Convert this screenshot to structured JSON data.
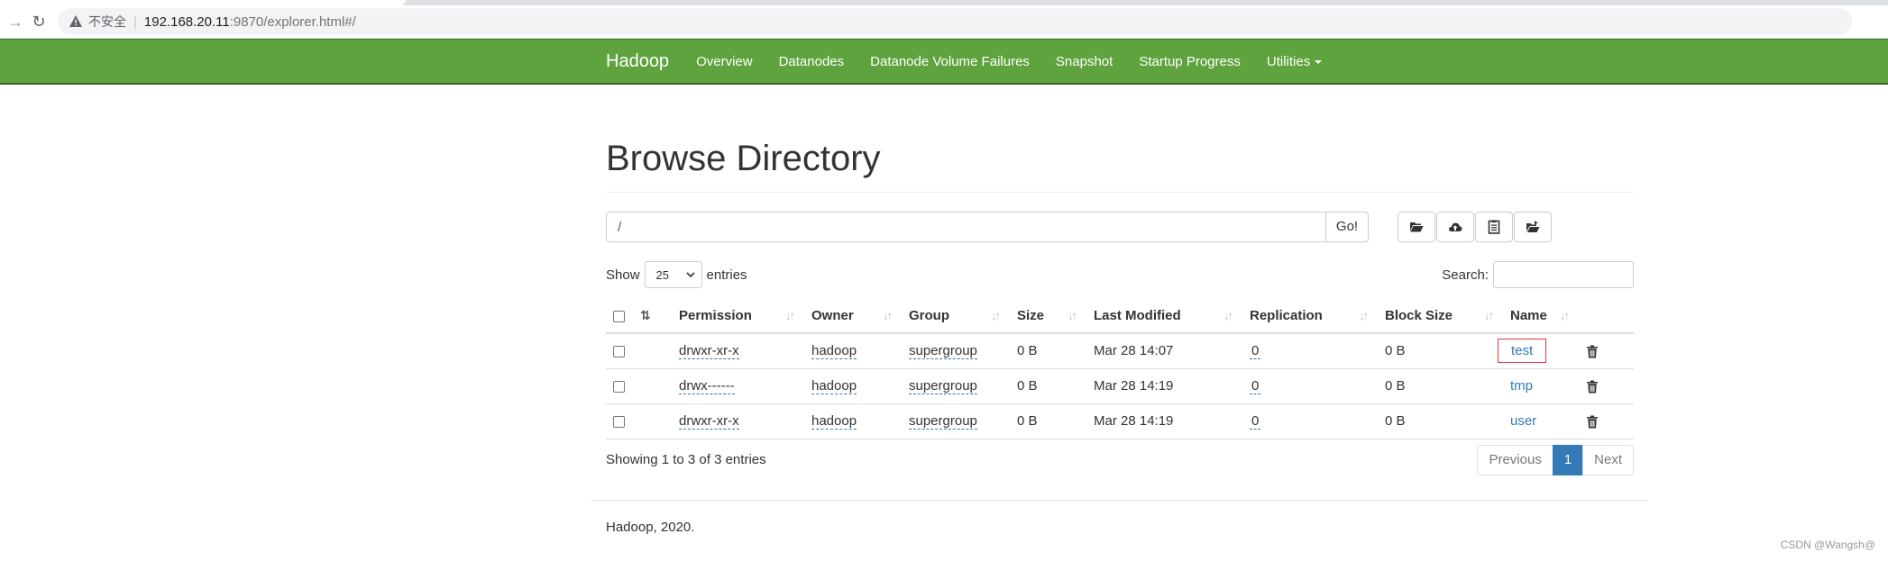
{
  "browser": {
    "insecure_label": "不安全",
    "url_host": "192.168.20.11",
    "url_path": ":9870/explorer.html#/"
  },
  "navbar": {
    "brand": "Hadoop",
    "links": [
      "Overview",
      "Datanodes",
      "Datanode Volume Failures",
      "Snapshot",
      "Startup Progress",
      "Utilities"
    ],
    "background_color": "#5fa33e"
  },
  "main": {
    "title": "Browse Directory",
    "path_value": "/",
    "go_label": "Go!",
    "toolbar_icons": [
      "folder-open-icon",
      "cloud-upload-icon",
      "clipboard-icon",
      "folder-open-alt-icon"
    ],
    "show_label": "Show",
    "entries_value": "25",
    "entries_label": "entries",
    "search_label": "Search:",
    "search_value": ""
  },
  "table": {
    "headers": [
      "Permission",
      "Owner",
      "Group",
      "Size",
      "Last Modified",
      "Replication",
      "Block Size",
      "Name"
    ],
    "rows": [
      {
        "permission": "drwxr-xr-x",
        "owner": "hadoop",
        "group": "supergroup",
        "size": "0 B",
        "modified": "Mar 28 14:07",
        "replication": "0",
        "block_size": "0 B",
        "name": "test"
      },
      {
        "permission": "drwx------",
        "owner": "hadoop",
        "group": "supergroup",
        "size": "0 B",
        "modified": "Mar 28 14:19",
        "replication": "0",
        "block_size": "0 B",
        "name": "tmp"
      },
      {
        "permission": "drwxr-xr-x",
        "owner": "hadoop",
        "group": "supergroup",
        "size": "0 B",
        "modified": "Mar 28 14:19",
        "replication": "0",
        "block_size": "0 B",
        "name": "user"
      }
    ]
  },
  "pagination": {
    "info": "Showing 1 to 3 of 3 entries",
    "previous": "Previous",
    "current": "1",
    "next": "Next"
  },
  "footer": {
    "text": "Hadoop, 2020."
  },
  "watermark": "CSDN @Wangsh@"
}
